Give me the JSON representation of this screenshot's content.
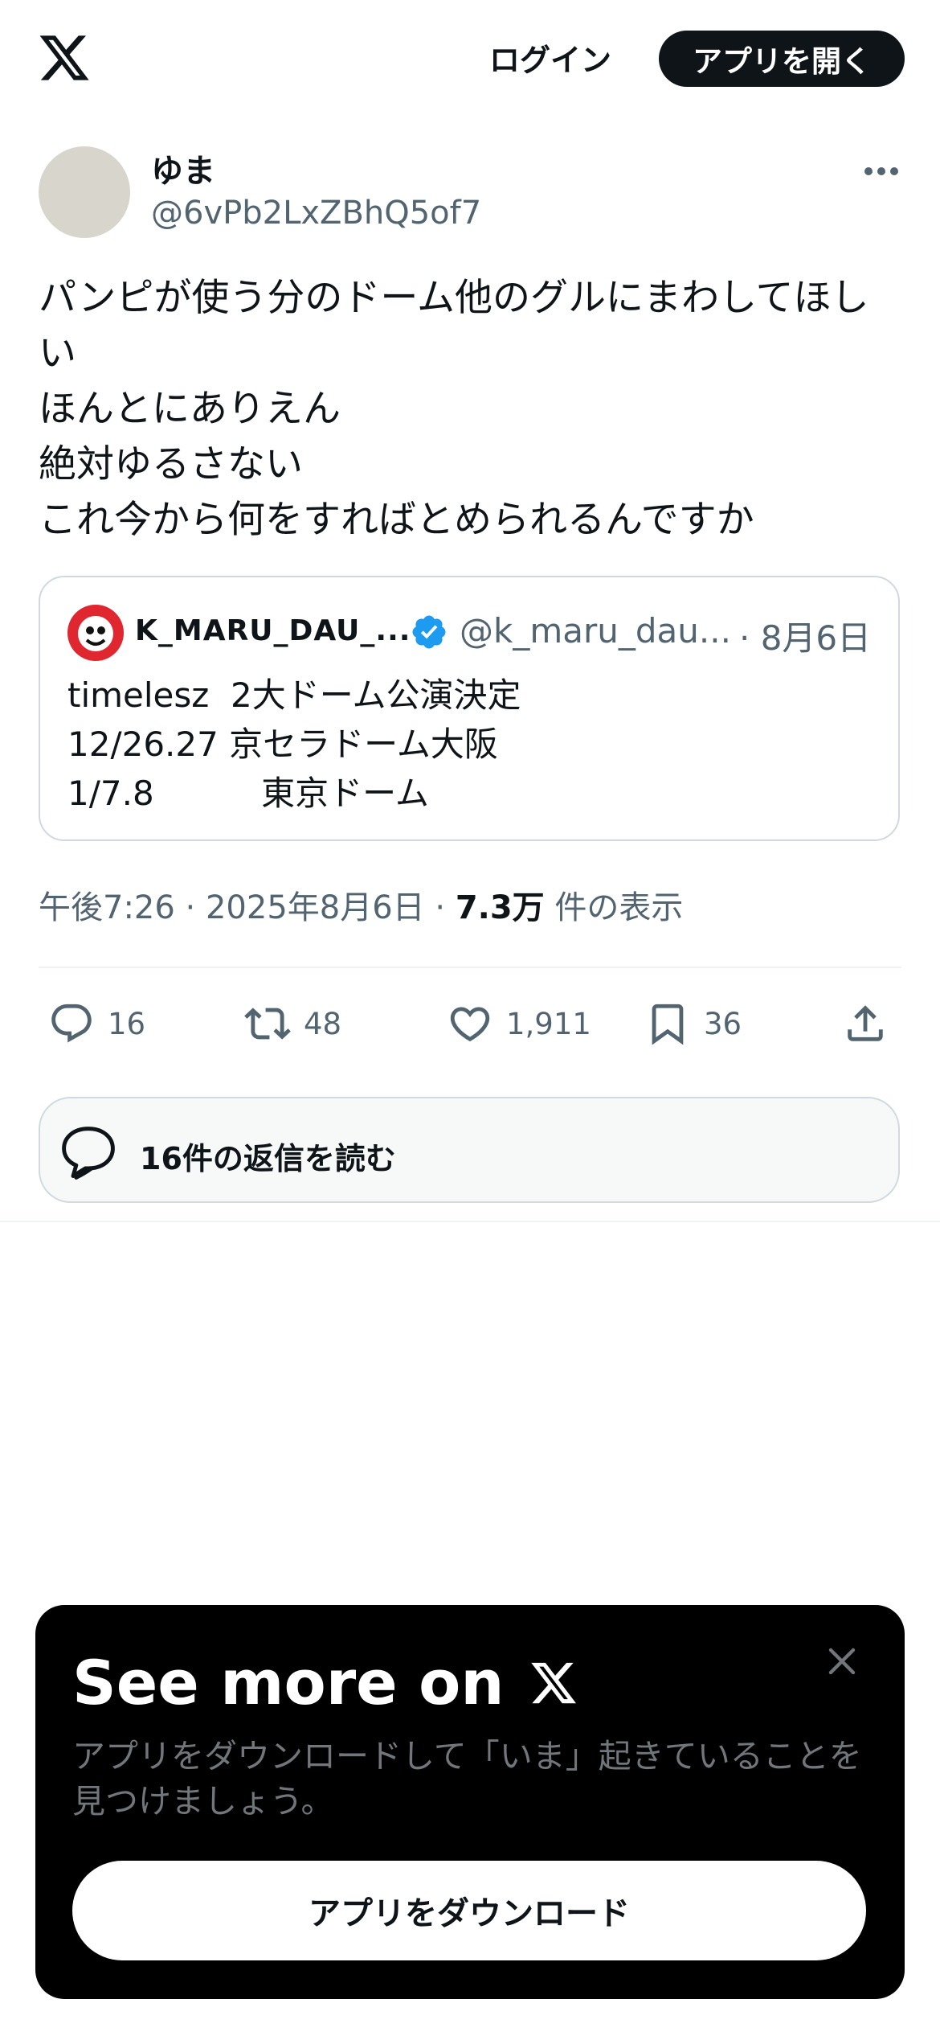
{
  "header": {
    "login_label": "ログイン",
    "open_app_label": "アプリを開く"
  },
  "tweet": {
    "author": {
      "display_name": "ゆま",
      "handle": "@6vPb2LxZBhQ5of7"
    },
    "text": "パンピが使う分のドーム他のグルにまわしてほしい\nほんとにありえん\n絶対ゆるさない\nこれ今から何をすればとめられるんですか",
    "quote": {
      "display_name": "K_MARU_DAU_...",
      "handle": "@k_maru_dau...",
      "date": "· 8月6日",
      "text": "timelesz  2大ドーム公演決定\n12/26.27 京セラドーム大阪\n1/7.8          東京ドーム"
    },
    "meta": {
      "time": "午後7:26 · 2025年8月6日 · ",
      "views_count": "7.3万",
      "views_label": " 件の表示"
    },
    "actions": {
      "replies": "16",
      "reposts": "48",
      "likes": "1,911",
      "bookmarks": "36"
    },
    "read_replies_label": "16件の返信を読む"
  },
  "sheet": {
    "title": "See more on",
    "description": "アプリをダウンロードして「いま」起きていることを見つけましょう。",
    "download_label": "アプリをダウンロード"
  },
  "icons": [
    "x-logo-icon",
    "more-icon",
    "verified-icon",
    "reply-icon",
    "repost-icon",
    "like-icon",
    "bookmark-icon",
    "share-icon",
    "conversation-icon",
    "close-icon"
  ],
  "colors": {
    "text_primary": "#0f1419",
    "text_secondary": "#536471",
    "border": "#cfd9de",
    "verified": "#1d9bf0",
    "sheet_bg": "#000000"
  }
}
